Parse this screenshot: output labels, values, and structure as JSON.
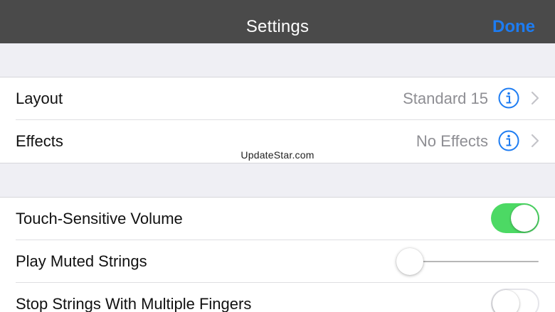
{
  "nav": {
    "title": "Settings",
    "done_label": "Done"
  },
  "section1": {
    "rows": [
      {
        "label": "Layout",
        "value": "Standard 15",
        "info_icon": "info-circle-icon",
        "chevron_icon": "chevron-right-icon"
      },
      {
        "label": "Effects",
        "value": "No Effects",
        "info_icon": "info-circle-icon",
        "chevron_icon": "chevron-right-icon"
      }
    ]
  },
  "section2": {
    "rows": [
      {
        "label": "Touch-Sensitive Volume",
        "control": "toggle",
        "on": true
      },
      {
        "label": "Play Muted Strings",
        "control": "slider",
        "value": 0.0
      },
      {
        "label": "Stop Strings With Multiple Fingers",
        "control": "toggle",
        "on": false
      }
    ]
  },
  "watermark": "UpdateStar.com",
  "colors": {
    "nav_background": "#4a4a4a",
    "accent": "#1d7cf2",
    "toggle_on": "#4cd964",
    "group_background": "#efeff4",
    "secondary_text": "#8e8e93"
  }
}
